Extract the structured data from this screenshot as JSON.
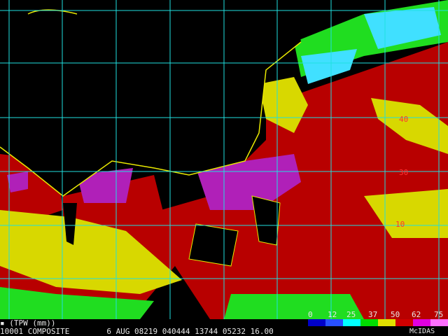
{
  "image_title": "TPW (mm)",
  "status_line": "10001 COMPOSITE        6 AUG 08219 040444 13744 05232 16.00",
  "credit": "McIDAS",
  "latitude_labels": [
    "40",
    "30",
    "10"
  ],
  "legend": {
    "values": [
      "0",
      "12",
      "25",
      "37",
      "50",
      "62",
      "75"
    ],
    "colors": [
      "#0000c8",
      "#2850ff",
      "#00ffff",
      "#00dd00",
      "#e0e000",
      "#d00000",
      "#e000e0",
      "#ff70ff"
    ]
  },
  "palette": {
    "ocean_moist": "#b80000",
    "deep_moist": "#9a0008",
    "mid_yellow": "#d8d800",
    "dry_green": "#20dd20",
    "very_dry_cyan": "#40e0ff",
    "max_purple": "#b020b8",
    "land_bg": "#000000",
    "grid": "#20e0e0"
  }
}
